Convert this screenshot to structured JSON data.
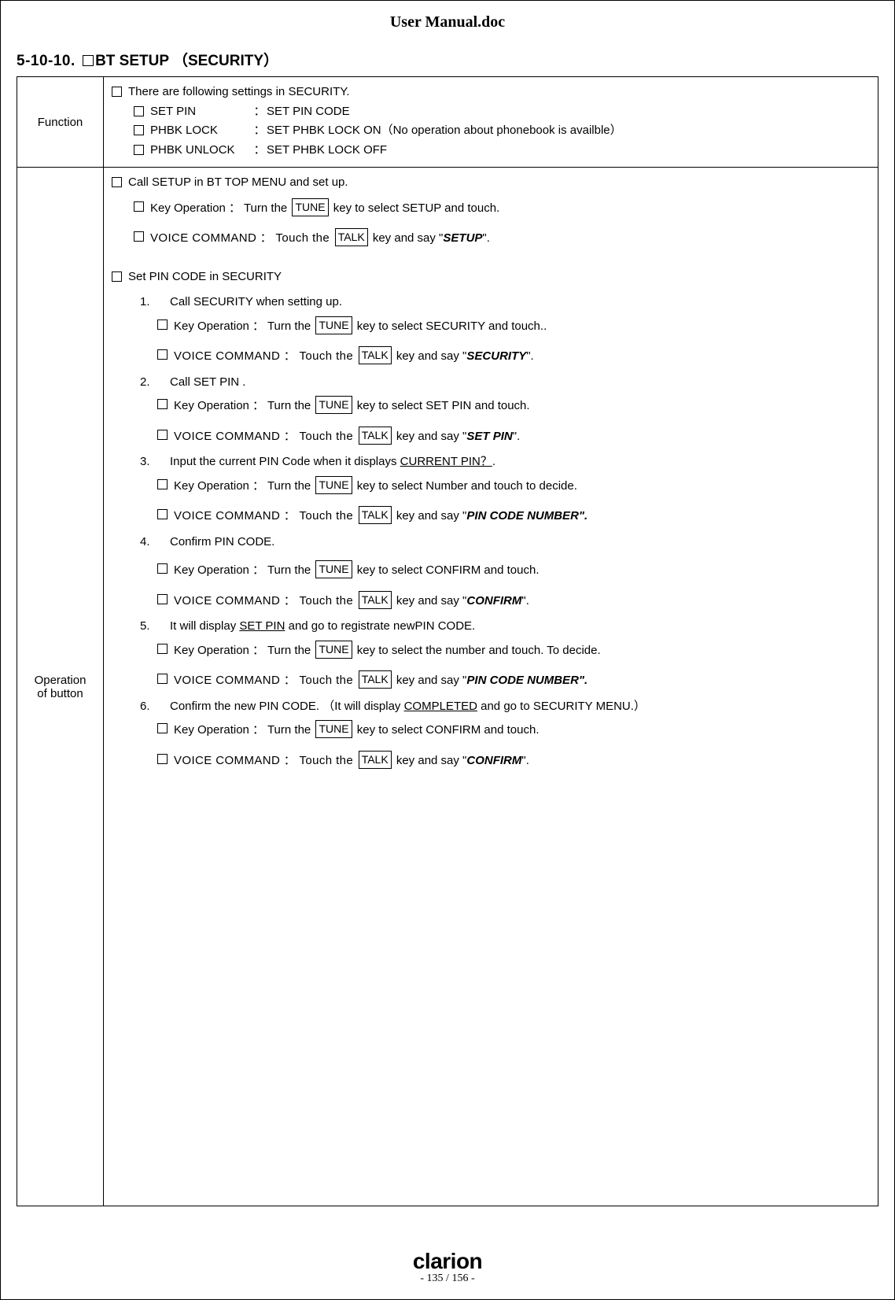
{
  "doc_title": "User Manual.doc",
  "section": {
    "number": "5-10-10.",
    "title": "BT SETUP （SECURITY）"
  },
  "function": {
    "label": "Function",
    "intro": "There are following settings in SECURITY.",
    "items": [
      {
        "name": "SET PIN",
        "desc": "SET PIN CODE"
      },
      {
        "name": "PHBK LOCK",
        "desc": "SET PHBK LOCK ON（No operation about phonebook is availble）"
      },
      {
        "name": "PHBK UNLOCK",
        "desc": "SET PHBK LOCK OFF"
      }
    ]
  },
  "operation": {
    "label_line1": "Operation",
    "label_line2": "of button",
    "intro": "Call SETUP in BT TOP MENU and set up.",
    "intro_key": {
      "pre": "Key Operation  ：   Turn the ",
      "key": "TUNE",
      "post": " key to select SETUP and touch."
    },
    "intro_vc": {
      "pre": "VOICE COMMAND  ：   Touch the ",
      "key": "TALK",
      "mid": " key and say \"",
      "cmd": "SETUP",
      "post": "\"."
    },
    "sub_heading": "Set PIN CODE in SECURITY",
    "steps": [
      {
        "num": "1.",
        "text": "Call SECURITY when setting up.",
        "key": {
          "pre": "Key Operation  ：   Turn the ",
          "key": "TUNE",
          "post": " key to select SECURITY and touch.."
        },
        "vc": {
          "pre": "VOICE COMMAND  ：   Touch the ",
          "key": "TALK",
          "mid": " key and say \"",
          "cmd": "SECURITY",
          "post": "\"."
        }
      },
      {
        "num": "2.",
        "text": "Call SET PIN .",
        "key": {
          "pre": "Key Operation  ：   Turn the ",
          "key": "TUNE",
          "post": " key to select SET PIN and touch."
        },
        "vc": {
          "pre": "VOICE COMMAND  ：   Touch the ",
          "key": "TALK",
          "mid": " key and say \"",
          "cmd": "SET PIN",
          "post": "\"."
        }
      },
      {
        "num": "3.",
        "text_pre": "Input the current PIN Code when it displays ",
        "text_ul": "CURRENT PIN？",
        "text_post": ".",
        "key": {
          "pre": "Key Operation  ：   Turn the ",
          "key": "TUNE",
          "post": " key to select Number and touch to decide."
        },
        "vc": {
          "pre": "VOICE COMMAND  ：   Touch the ",
          "key": "TALK",
          "mid": " key and say \"",
          "cmd": "PIN CODE NUMBER\".",
          "post": ""
        }
      },
      {
        "num": "4.",
        "text": "Confirm PIN CODE.",
        "key": {
          "pre": "Key Operation  ：   Turn the ",
          "key": "TUNE",
          "post": " key to select CONFIRM and touch."
        },
        "vc": {
          "pre": "VOICE COMMAND  ：   Touch the ",
          "key": "TALK",
          "mid": " key and say \"",
          "cmd": "CONFIRM",
          "post": "\"."
        }
      },
      {
        "num": "5.",
        "text_pre": "It will display ",
        "text_ul": "SET PIN",
        "text_post": " and go to registrate newPIN CODE.",
        "key": {
          "pre": "Key Operation  ：   Turn the ",
          "key": "TUNE",
          "post": " key to select the number and touch. To decide."
        },
        "vc": {
          "pre": "VOICE COMMAND  ：   Touch the ",
          "key": "TALK",
          "mid": " key and say \"",
          "cmd": "PIN CODE NUMBER\".",
          "post": ""
        }
      },
      {
        "num": "6.",
        "text_pre": "Confirm the new PIN CODE. （It will display ",
        "text_ul": "COMPLETED",
        "text_post": " and go to SECURITY MENU.）",
        "key": {
          "pre": "Key Operation  ：   Turn the ",
          "key": "TUNE",
          "post": " key to select CONFIRM and touch."
        },
        "vc": {
          "pre": "VOICE COMMAND  ：   Touch the ",
          "key": "TALK",
          "mid": " key and say \"",
          "cmd": "CONFIRM",
          "post": "\"."
        }
      }
    ]
  },
  "footer": {
    "brand": "clarion",
    "page": "- 135 / 156 -"
  }
}
